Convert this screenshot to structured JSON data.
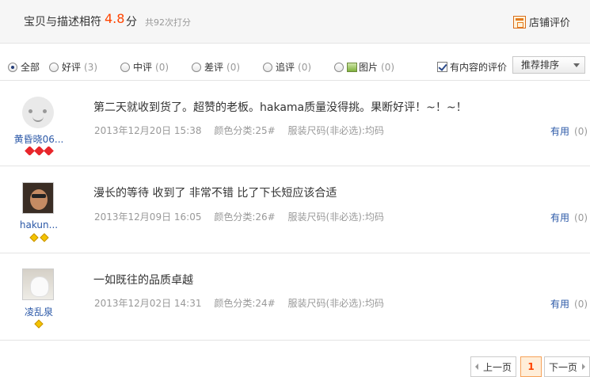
{
  "summary": {
    "label": "宝贝与描述相符",
    "score": "4.8",
    "unit": "分",
    "count_text": "共92次打分",
    "shop_link": "店铺评价"
  },
  "filters": {
    "all": {
      "label": "全部",
      "selected": true
    },
    "good": {
      "label": "好评",
      "count": "(3)"
    },
    "medium": {
      "label": "中评",
      "count": "(0)"
    },
    "bad": {
      "label": "差评",
      "count": "(0)"
    },
    "followup": {
      "label": "追评",
      "count": "(0)"
    },
    "photo": {
      "label": "图片",
      "count": "(0)"
    },
    "has_content": {
      "label": "有内容的评价",
      "checked": true
    },
    "sort": {
      "selected": "推荐排序"
    }
  },
  "reviews": [
    {
      "user": "黄昏晓06...",
      "content": "第二天就收到货了。超赞的老板。hakama质量没得挑。果断好评！~！~！",
      "date": "2013年12月20日 15:38",
      "color": "颜色分类:25#",
      "size": "服装尺码(非必选):均码",
      "useful_label": "有用",
      "useful_count": "(0)"
    },
    {
      "user": "hakun...",
      "content": "漫长的等待 收到了 非常不错 比了下长短应该合适",
      "date": "2013年12月09日 16:05",
      "color": "颜色分类:26#",
      "size": "服装尺码(非必选):均码",
      "useful_label": "有用",
      "useful_count": "(0)"
    },
    {
      "user": "凌乱泉",
      "content": "一如既往的品质卓越",
      "date": "2013年12月02日 14:31",
      "color": "颜色分类:24#",
      "size": "服装尺码(非必选):均码",
      "useful_label": "有用",
      "useful_count": "(0)"
    }
  ],
  "pagination": {
    "prev": "上一页",
    "current": "1",
    "next": "下一页"
  }
}
